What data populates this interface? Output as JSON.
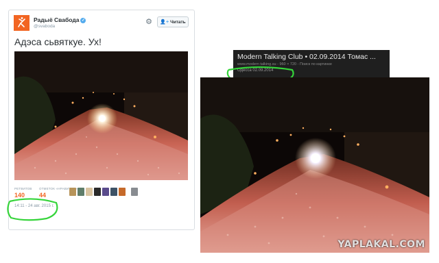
{
  "tweet": {
    "account_name": "Радыё Свабода",
    "handle": "@svaboda",
    "follow_label": "Читать",
    "text": "Адэса сьвяткуе. Ух!",
    "stats": [
      {
        "label": "РЕТВИТОВ",
        "value": "140"
      },
      {
        "label": "ОТМЕТОК «НРАВИТСЯ»",
        "value": "44"
      }
    ],
    "timestamp": "14:11 - 24 авг. 2015 г.",
    "icons": {
      "avatar": "liberty-logo-icon",
      "verified": "verified-icon",
      "gear": "gear-icon",
      "follow": "follow-icon"
    },
    "colors": {
      "accent": "#f26522",
      "verified": "#55acee",
      "highlight": "#35d43a"
    }
  },
  "search_result": {
    "title": "Modern Talking Club • 02.09.2014 Томас ...",
    "meta": "www.modern talking.su  -  960 × 720  -  Поиск по картинке",
    "caption": "Одесса 02.09.2014"
  },
  "watermark": "YAPLAKAL.COM"
}
